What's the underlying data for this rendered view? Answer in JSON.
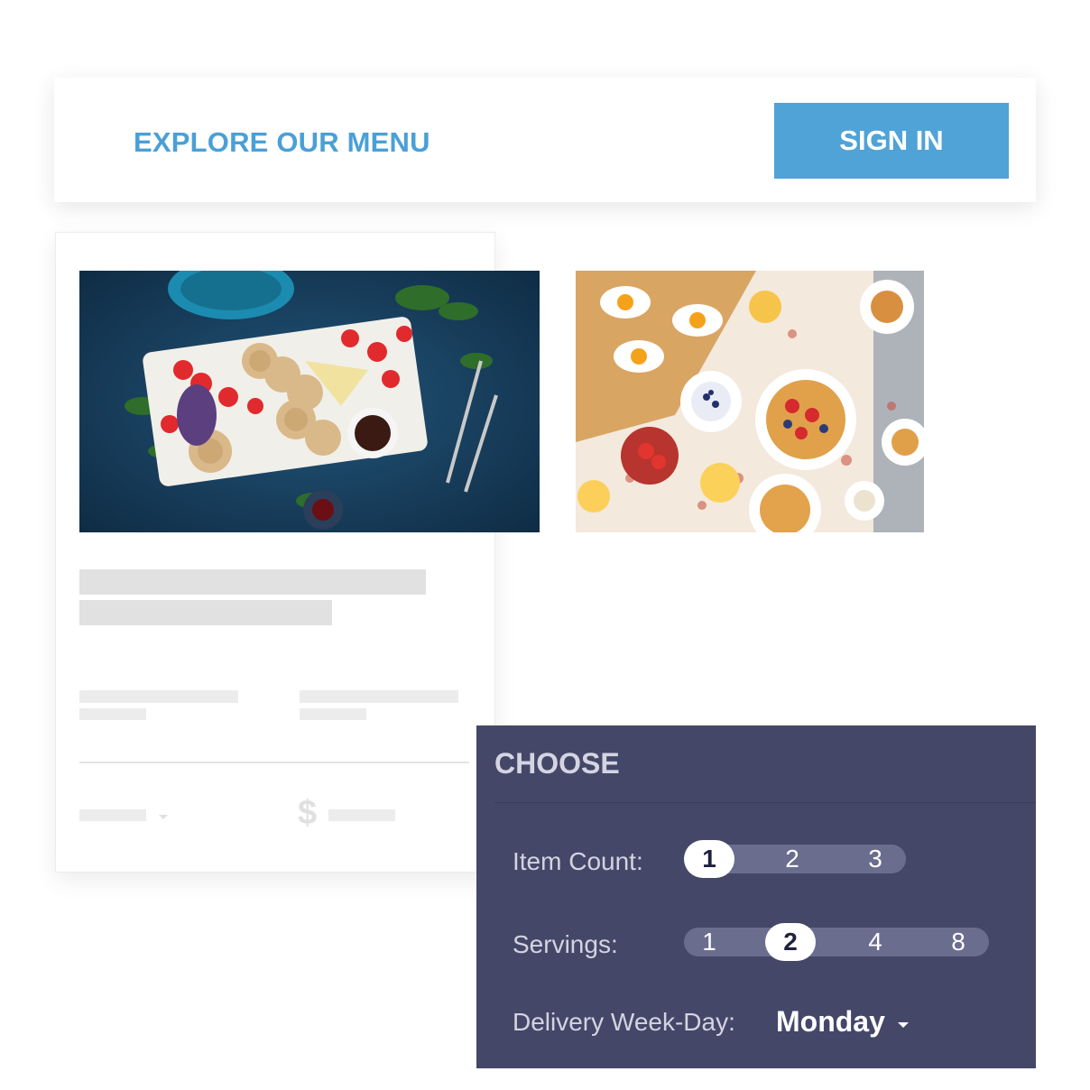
{
  "header": {
    "menu_link": "EXPLORE OUR MENU",
    "signin_label": "SIGN IN"
  },
  "images": [
    {
      "name": "snack-platter-photo",
      "accent": "#1f4a6a"
    },
    {
      "name": "breakfast-spread-photo",
      "accent": "#f2e6d5"
    }
  ],
  "card": {
    "currency_symbol": "$"
  },
  "choose": {
    "title": "CHOOSE",
    "item_count_label": "Item Count:",
    "item_count_options": [
      "1",
      "2",
      "3"
    ],
    "item_count_selected": "1",
    "servings_label": "Servings:",
    "servings_options": [
      "1",
      "2",
      "4",
      "8"
    ],
    "servings_selected": "2",
    "weekday_label": "Delivery Week-Day:",
    "weekday_value": "Monday"
  },
  "colors": {
    "accent": "#4fa3d7",
    "panel": "#454769",
    "pill": "#6b6d8e"
  }
}
